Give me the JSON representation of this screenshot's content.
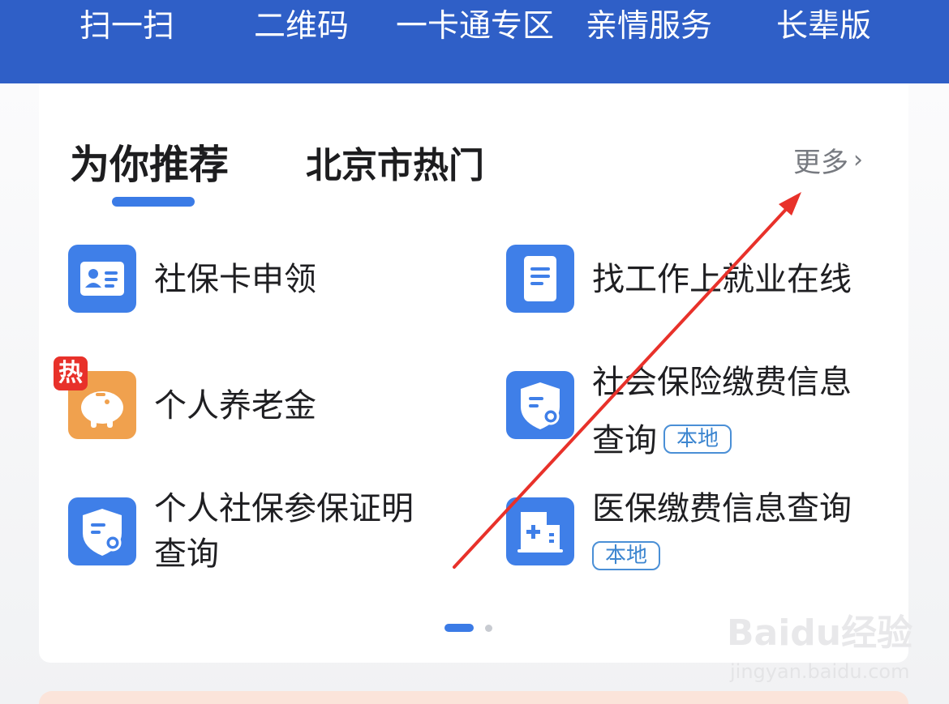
{
  "toolbar": {
    "items": [
      "扫一扫",
      "二维码",
      "一卡通专区",
      "亲情服务",
      "长辈版"
    ]
  },
  "recommend": {
    "tabs": [
      "为你推荐",
      "北京市热门"
    ],
    "more_label": "更多",
    "hot_badge": "热",
    "services": [
      {
        "label": "社保卡申领",
        "icon": "id-card-icon"
      },
      {
        "label": "找工作上就业在线",
        "icon": "document-icon"
      },
      {
        "label": "个人养老金",
        "icon": "piggy-bank-icon"
      },
      {
        "label_line1": "社会保险缴费信息",
        "label_line2": "查询",
        "tag": "本地",
        "icon": "shield-search-icon"
      },
      {
        "label_line1": "个人社保参保证明",
        "label_line2": "查询",
        "icon": "shield-search-icon"
      },
      {
        "label": "医保缴费信息查询",
        "tag": "本地",
        "icon": "medical-card-icon"
      }
    ]
  },
  "watermark": {
    "brand": "Baidu经验",
    "url": "jingyan.baidu.com"
  },
  "colors": {
    "header": "#2f5fc7",
    "accent": "#3b7be6",
    "icon_blue": "#3f7fe8",
    "icon_orange": "#f0a14e",
    "hot": "#e8312a",
    "annotation_arrow": "#e8312a"
  }
}
